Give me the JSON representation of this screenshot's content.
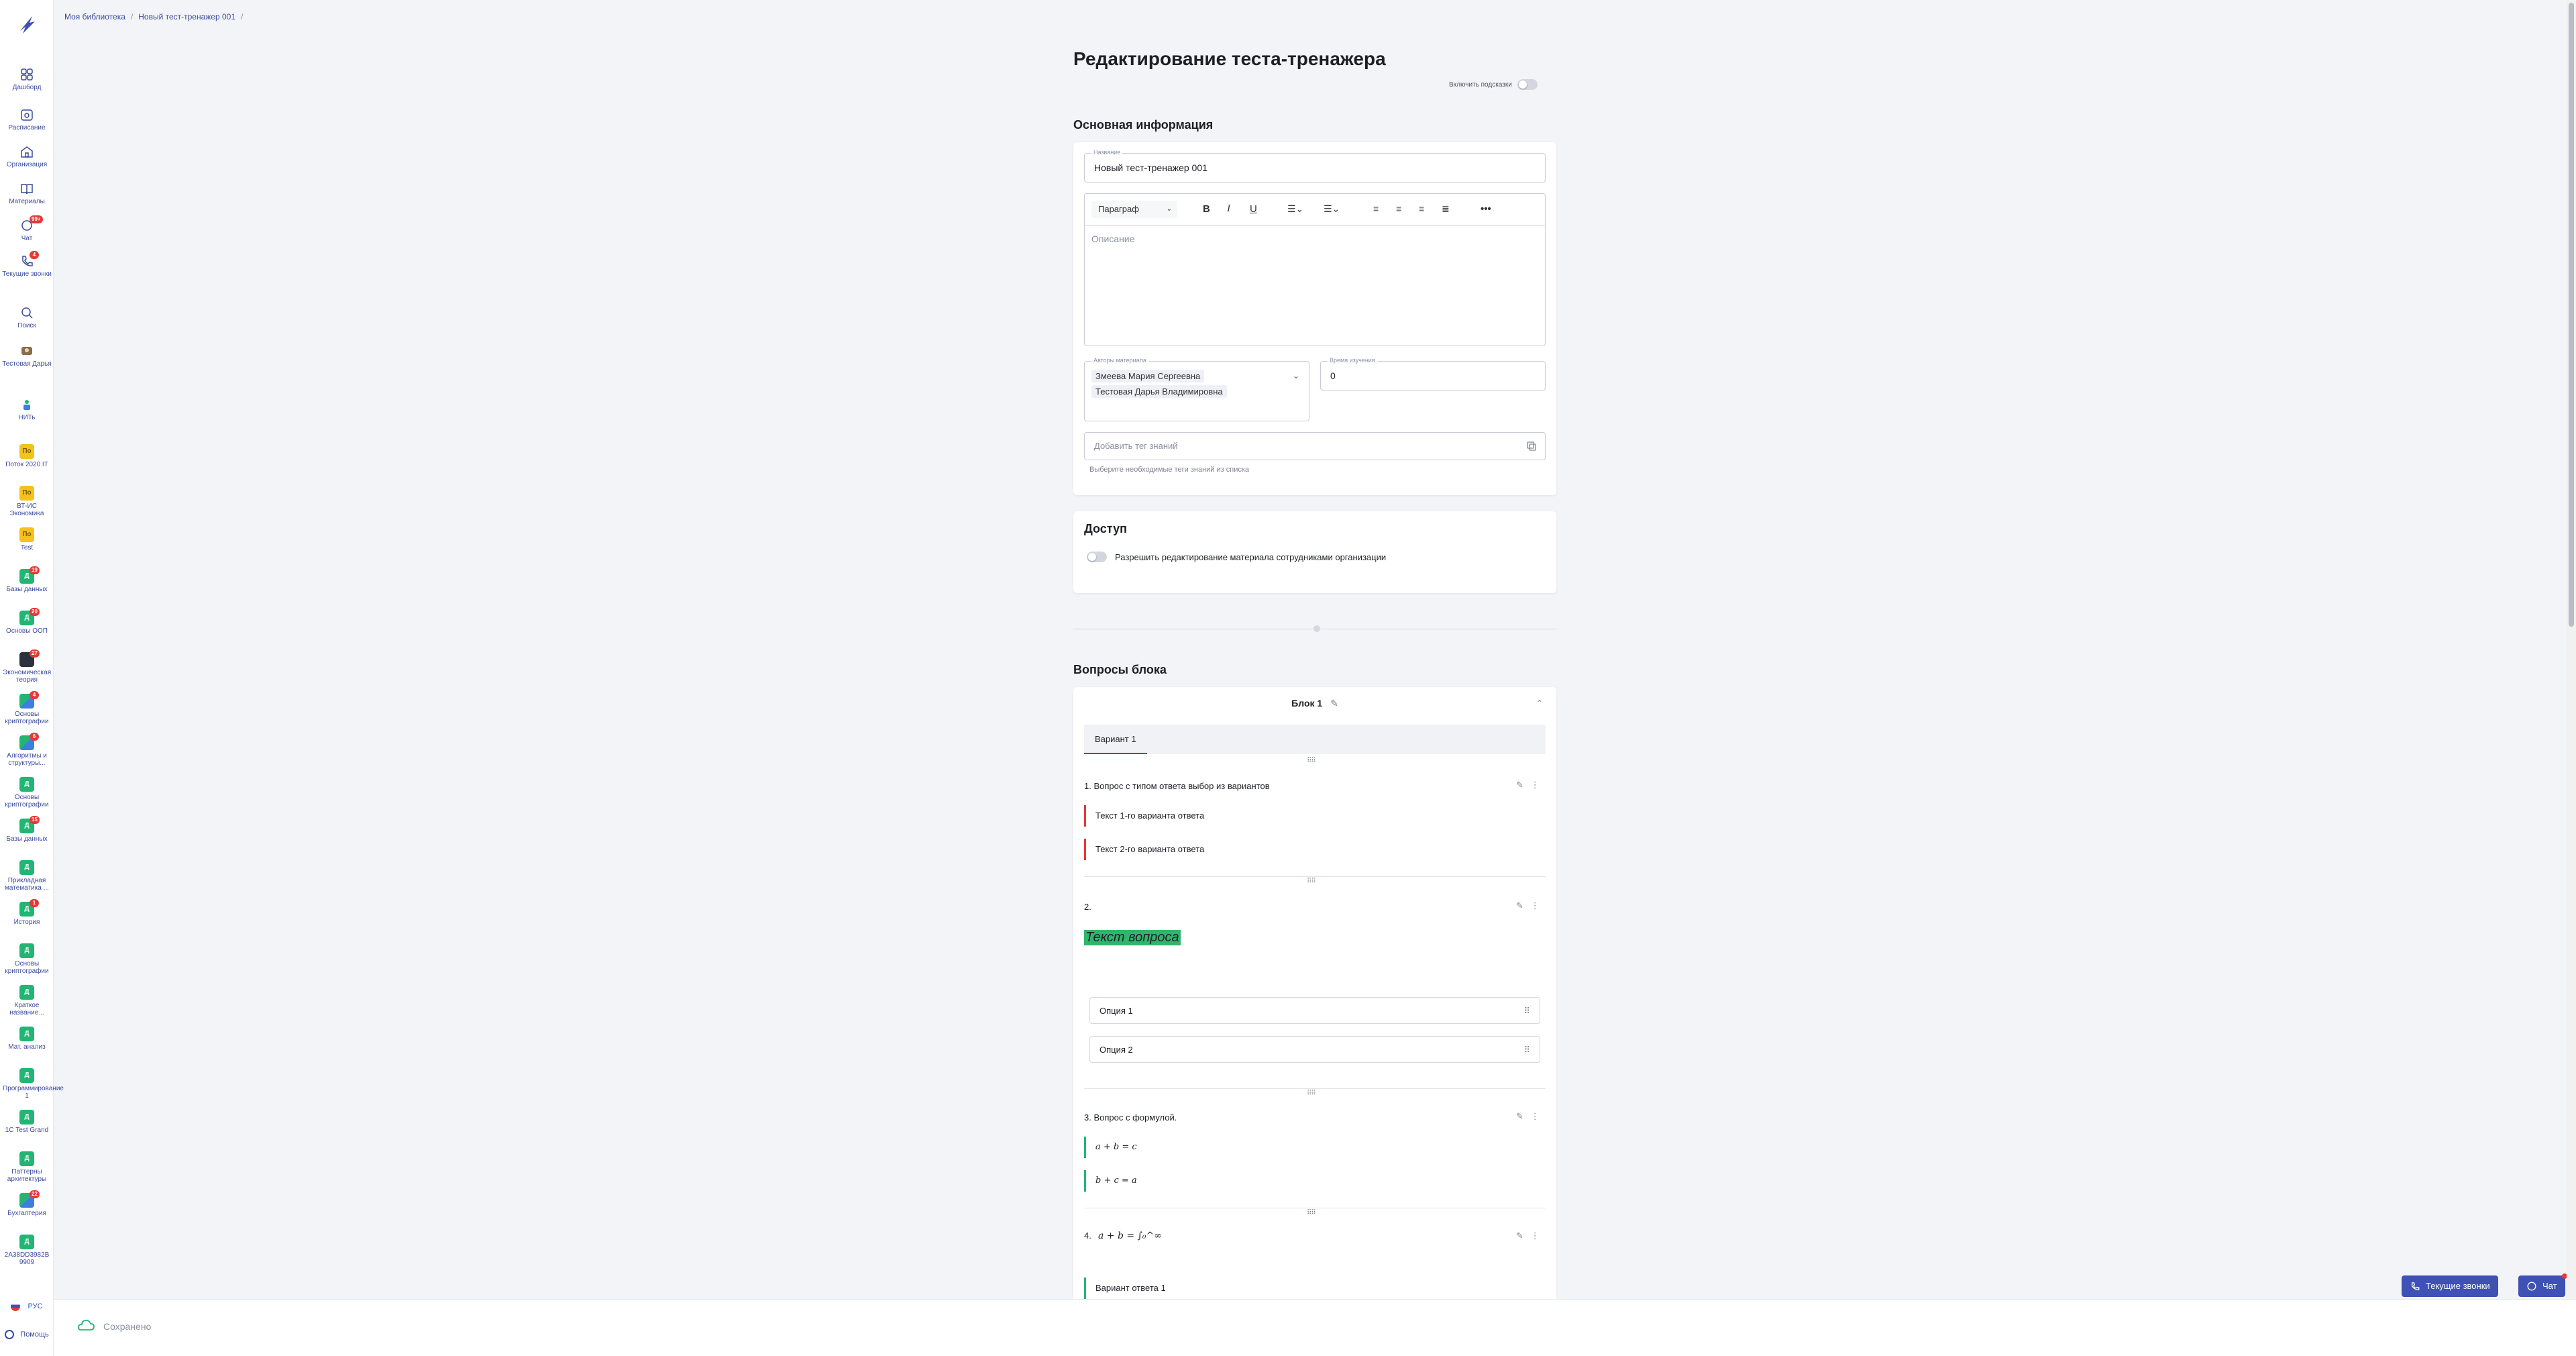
{
  "breadcrumb": [
    "Моя библиотека",
    "Новый тест-тренажер 001"
  ],
  "sidebar": {
    "items": [
      {
        "label": "Дашборд",
        "icon": "dashboard-icon"
      },
      {
        "label": "Расписание",
        "icon": "calendar-icon"
      },
      {
        "label": "Организация",
        "icon": "building-icon"
      },
      {
        "label": "Материалы",
        "icon": "book-icon"
      },
      {
        "label": "Чат",
        "icon": "chat-icon",
        "badge": "99+"
      },
      {
        "label": "Текущие звонки",
        "icon": "phone-icon",
        "badge": "4"
      },
      {
        "label": "Поиск",
        "icon": "search-icon"
      },
      {
        "label": "Тестовая Дарья",
        "icon": "avatar-icon"
      },
      {
        "label": "НИТь",
        "icon": "nit-icon"
      }
    ],
    "groups": [
      {
        "label": "Поток 2020 IT",
        "tile": "По",
        "color": "yellow"
      },
      {
        "label": "ВТ-ИС Экономика",
        "tile": "По",
        "color": "yellow"
      },
      {
        "label": "Test",
        "tile": "По",
        "color": "yellow"
      },
      {
        "label": "Базы данных",
        "tile": "Д",
        "color": "green",
        "badge": "19"
      },
      {
        "label": "Основы ООП",
        "tile": "Д",
        "color": "green",
        "badge": "20"
      },
      {
        "label": "Экономическая теория",
        "tile": "",
        "color": "dark",
        "badge": "27"
      },
      {
        "label": "Основы криптографии",
        "tile": "",
        "color": "multi",
        "badge": "4"
      },
      {
        "label": "Алгоритмы и структуры...",
        "tile": "",
        "color": "multi",
        "badge": "6"
      },
      {
        "label": "Основы криптографии",
        "tile": "Д",
        "color": "green"
      },
      {
        "label": "Базы данных",
        "tile": "Д",
        "color": "green",
        "badge": "15"
      },
      {
        "label": "Прикладная математика ...",
        "tile": "Д",
        "color": "green"
      },
      {
        "label": "История",
        "tile": "Д",
        "color": "green",
        "badge": "1"
      },
      {
        "label": "Основы криптографии",
        "tile": "Д",
        "color": "green"
      },
      {
        "label": "Краткое название...",
        "tile": "Д",
        "color": "green"
      },
      {
        "label": "Мат. анализ",
        "tile": "Д",
        "color": "green"
      },
      {
        "label": "Программирование 1",
        "tile": "Д",
        "color": "green"
      },
      {
        "label": "1С Test Grand",
        "tile": "Д",
        "color": "green"
      },
      {
        "label": "Паттерны архитектуры",
        "tile": "Д",
        "color": "green"
      },
      {
        "label": "Бухгалтерия",
        "tile": "",
        "color": "multi",
        "badge": "22"
      },
      {
        "label": "2A38DD3982B 9909",
        "tile": "Д",
        "color": "green"
      }
    ],
    "lang": "РУС",
    "help": "Помощь"
  },
  "page": {
    "title": "Редактирование теста-тренажера",
    "hints_label": "Включить подсказки"
  },
  "basic_info": {
    "section_title": "Основная информация",
    "name_label": "Название",
    "name_value": "Новый тест-тренажер 001",
    "toolbar": {
      "paragraph": "Параграф"
    },
    "description_placeholder": "Описание",
    "authors_label": "Авторы материала",
    "authors": [
      "Змеева Мария Сергеевна",
      "Тестовая Дарья Владимировна"
    ],
    "study_time_label": "Время изучения",
    "study_time_value": "0",
    "tags_placeholder": "Добавить тег знаний",
    "tags_helper": "Выберите необходимые теги знаний из списка"
  },
  "access": {
    "section_title": "Доступ",
    "toggle_label": "Разрешить редактирование материала сотрудниками организации"
  },
  "questions": {
    "section_title": "Вопросы блока",
    "block_title": "Блок 1",
    "tab": "Вариант 1",
    "q1": {
      "title": "1. Вопрос с типом ответа выбор из вариантов",
      "answers": [
        "Текст 1-го варианта ответа",
        "Текст 2-го варианта ответа"
      ]
    },
    "q2": {
      "title": "2.",
      "text": "Текст вопроса",
      "options": [
        "Опция 1",
        "Опция 2"
      ]
    },
    "q3": {
      "title": "3. Вопрос с формулой.",
      "answers": [
        "a + b = c",
        "b + c = a"
      ]
    },
    "q4": {
      "title_num": "4.",
      "formula": "a + b = ∫₀^∞",
      "answers": [
        "Вариант ответа 1"
      ]
    }
  },
  "bottom": {
    "saved": "Сохранено",
    "calls_button": "Текущие звонки",
    "chat_button": "Чат"
  },
  "colors": {
    "accent": "#3f51b5",
    "danger": "#e53935",
    "success": "#22b573",
    "highlight": "#2fb66c"
  }
}
